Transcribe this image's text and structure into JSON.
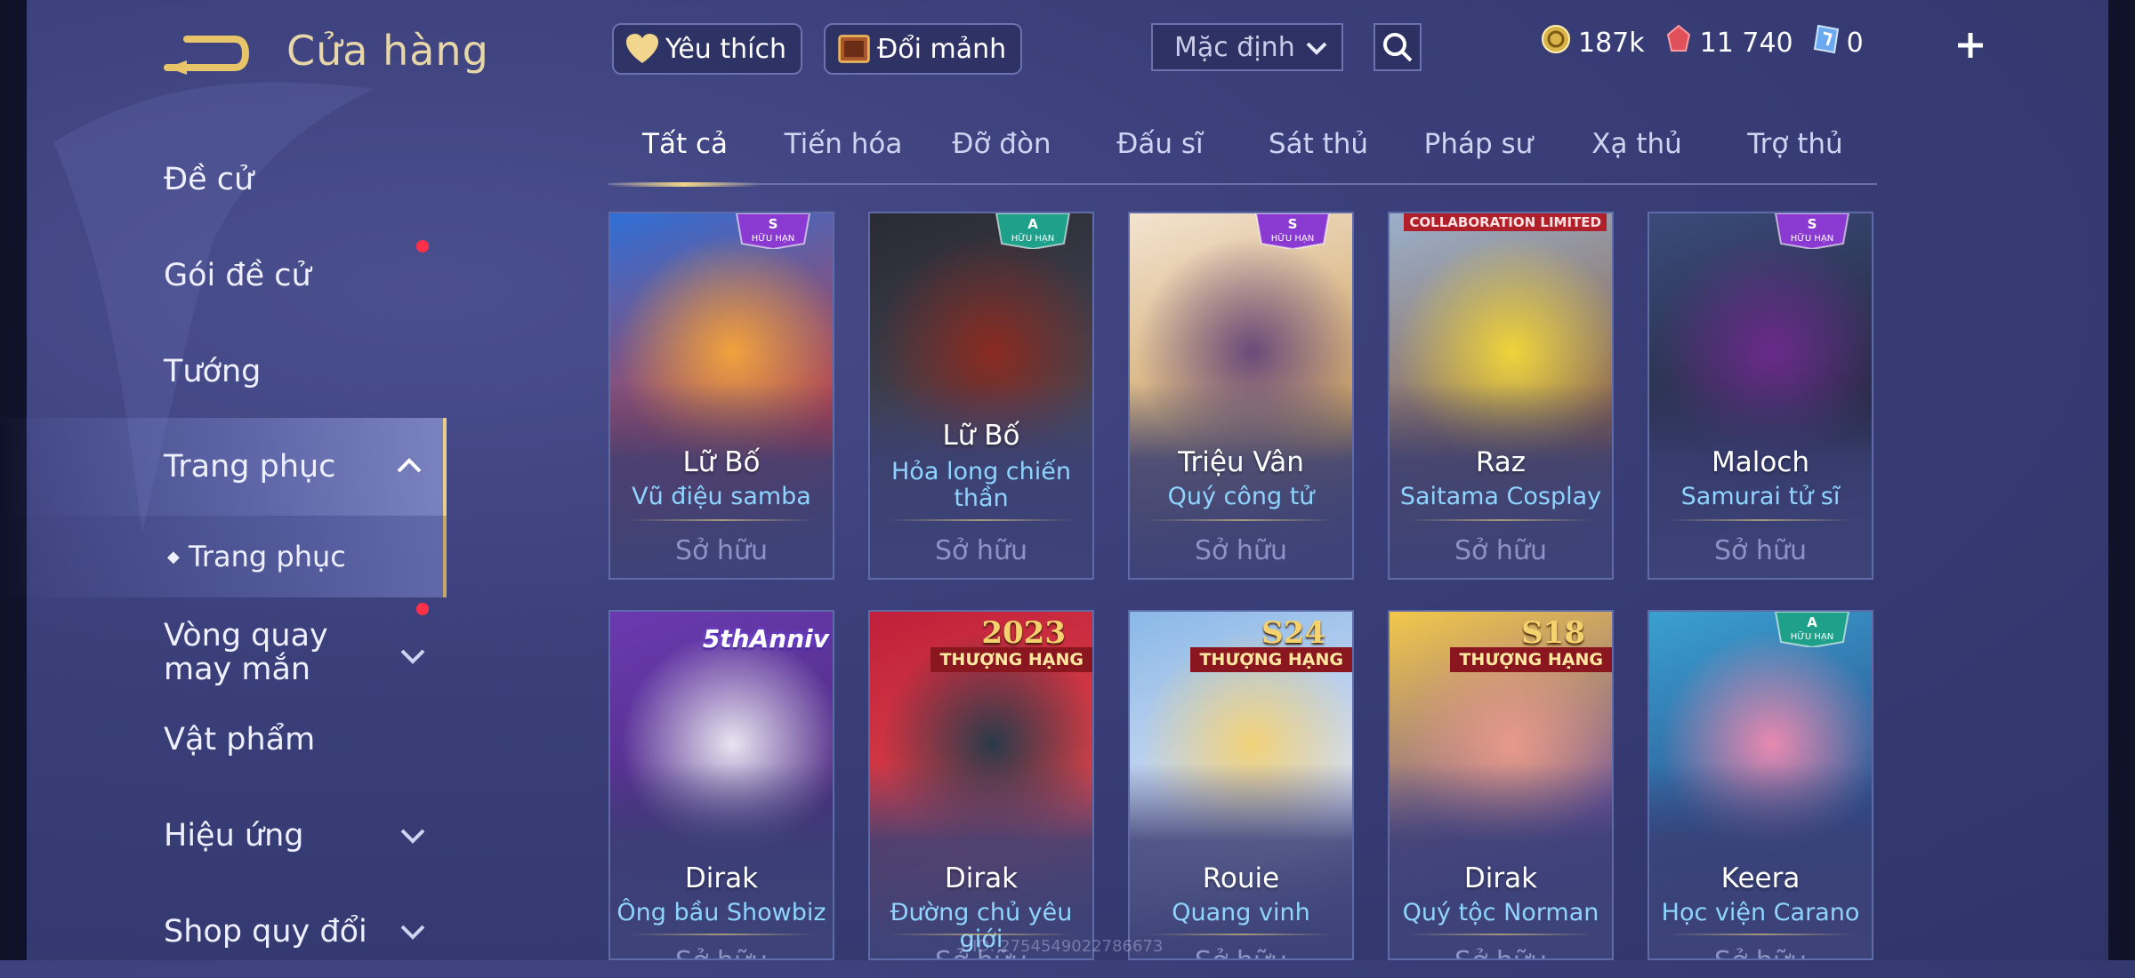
{
  "header": {
    "title": "Cửa hàng",
    "favorites_label": "Yêu thích",
    "exchange_label": "Đổi mảnh",
    "sort_selected": "Mặc định",
    "currencies": [
      {
        "icon": "gold-coin-icon",
        "value": "187k"
      },
      {
        "icon": "ruby-icon",
        "value": "11 740"
      },
      {
        "icon": "voucher-icon",
        "value": "0"
      }
    ]
  },
  "sidebar": {
    "items": [
      {
        "label": "Đề cử"
      },
      {
        "label": "Gói đề cử",
        "notify": true
      },
      {
        "label": "Tướng"
      },
      {
        "label": "Trang phục",
        "active": true,
        "expanded": true
      },
      {
        "label": "Trang phục",
        "sub": true
      },
      {
        "label": "Vòng quay may mắn",
        "notify": true
      },
      {
        "label": "Vật phẩm"
      },
      {
        "label": "Hiệu ứng"
      },
      {
        "label": "Shop quy đổi"
      }
    ]
  },
  "tabs": [
    "Tất cả",
    "Tiến hóa",
    "Đỡ đòn",
    "Đấu sĩ",
    "Sát thủ",
    "Pháp sư",
    "Xạ thủ",
    "Trợ thủ"
  ],
  "active_tab": "Tất cả",
  "cards": [
    {
      "hero": "Lữ Bố",
      "skin": "Vũ điệu samba",
      "status": "Sở hữu",
      "badge_rank": "S",
      "badge_text": "HỮU HẠN",
      "art": [
        "#2f6fd6",
        "#f2a23c",
        "#c83a3a"
      ]
    },
    {
      "hero": "Lữ Bố",
      "skin": "Hỏa long chiến thần",
      "status": "Sở hữu",
      "badge_rank": "A",
      "badge_text": "HỮU HẠN",
      "art": [
        "#2a2a34",
        "#8a2a20",
        "#4a4a58"
      ]
    },
    {
      "hero": "Triệu Vân",
      "skin": "Quý công tử",
      "status": "Sở hữu",
      "badge_rank": "S",
      "badge_text": "HỮU HẠN",
      "art": [
        "#f3e3d0",
        "#6a4a7a",
        "#c89a52"
      ]
    },
    {
      "hero": "Raz",
      "skin": "Saitama Cosplay",
      "status": "Sở hữu",
      "collab": "COLLABORATION LIMITED",
      "art": [
        "#9ab0cc",
        "#f0d43a",
        "#8a5a3a"
      ]
    },
    {
      "hero": "Maloch",
      "skin": "Samurai tử sĩ",
      "status": "Sở hữu",
      "badge_rank": "S",
      "badge_text": "HỮU HẠN",
      "art": [
        "#3a4a7a",
        "#6a2a8a",
        "#222436"
      ]
    },
    {
      "hero": "Dirak",
      "skin": "Ông bầu Showbiz",
      "status": "Sở hữu",
      "anniv": "5thAnniv",
      "art": [
        "#6a3ab0",
        "#e8e4f0",
        "#4a2a7a"
      ]
    },
    {
      "hero": "Dirak",
      "skin": "Đường chủ yêu giới",
      "status": "Sở hữu",
      "season": "2023",
      "ribbon": "THƯỢNG HẠNG",
      "art": [
        "#c0203a",
        "#2a3a4a",
        "#e04a4a"
      ]
    },
    {
      "hero": "Rouie",
      "skin": "Quang vinh",
      "status": "Sở hữu",
      "season": "S24",
      "ribbon": "THƯỢNG HẠNG",
      "art": [
        "#8ab8e8",
        "#f2d27a",
        "#e8e8f4"
      ]
    },
    {
      "hero": "Dirak",
      "skin": "Quý tộc Norman",
      "status": "Sở hữu",
      "season": "S18",
      "ribbon": "THƯỢNG HẠNG",
      "art": [
        "#f2c84a",
        "#e89a8a",
        "#6a4aa0"
      ]
    },
    {
      "hero": "Keera",
      "skin": "Học viện Carano",
      "status": "Sở hữu",
      "badge_rank": "A",
      "badge_text": "HỮU HẠN",
      "art": [
        "#3aa0d0",
        "#e88ab0",
        "#2a4a8a"
      ]
    }
  ],
  "uid": "UID: 2754549022786673",
  "colors": {
    "accent_gold": "#e7cf8a",
    "skin_name": "#8ed4ff",
    "owned": "#8d93c4",
    "notify": "#ff3048"
  }
}
